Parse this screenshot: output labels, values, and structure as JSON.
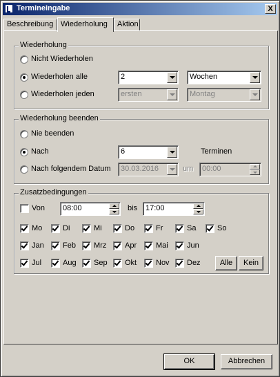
{
  "window": {
    "title": "Termineingabe",
    "close_glyph": "X"
  },
  "tabs": [
    "Beschreibung",
    "Wiederholung",
    "Aktion"
  ],
  "active_tab": "Wiederholung",
  "wiederholung": {
    "legend": "Wiederholung",
    "options": {
      "nicht": "Nicht Wiederholen",
      "alle": "Wiederholen alle",
      "jeden": "Wiederholen jeden"
    },
    "selected": "alle",
    "alle_count": "2",
    "alle_unit": "Wochen",
    "jeden_which": "ersten",
    "jeden_day": "Montag"
  },
  "beenden": {
    "legend": "Wiederholung beenden",
    "options": {
      "nie": "Nie beenden",
      "nach": "Nach",
      "datum": "Nach folgendem Datum"
    },
    "selected": "nach",
    "nach_count": "6",
    "terminen_label": "Terminen",
    "date": "30.03.2016",
    "um_label": "um",
    "time": "00:00"
  },
  "zusatz": {
    "legend": "Zusatzbedingungen",
    "von_label": "Von",
    "von_checked": false,
    "von_time": "08:00",
    "bis_label": "bis",
    "bis_time": "17:00",
    "weekdays": [
      {
        "label": "Mo",
        "checked": true
      },
      {
        "label": "Di",
        "checked": true
      },
      {
        "label": "Mi",
        "checked": true
      },
      {
        "label": "Do",
        "checked": true
      },
      {
        "label": "Fr",
        "checked": true
      },
      {
        "label": "Sa",
        "checked": true
      },
      {
        "label": "So",
        "checked": true
      }
    ],
    "months_row1": [
      {
        "label": "Jan",
        "checked": true
      },
      {
        "label": "Feb",
        "checked": true
      },
      {
        "label": "Mrz",
        "checked": true
      },
      {
        "label": "Apr",
        "checked": true
      },
      {
        "label": "Mai",
        "checked": true
      },
      {
        "label": "Jun",
        "checked": true
      }
    ],
    "months_row2": [
      {
        "label": "Jul",
        "checked": true
      },
      {
        "label": "Aug",
        "checked": true
      },
      {
        "label": "Sep",
        "checked": true
      },
      {
        "label": "Okt",
        "checked": true
      },
      {
        "label": "Nov",
        "checked": true
      },
      {
        "label": "Dez",
        "checked": true
      }
    ],
    "alle_button": "Alle",
    "kein_button": "Kein"
  },
  "footer": {
    "ok": "OK",
    "cancel": "Abbrechen"
  },
  "colors": {
    "face": "#d4d0c8",
    "title_start": "#0a246a",
    "title_end": "#a6caf0"
  },
  "icons": {
    "app": "calendar-app-icon",
    "close": "close-icon"
  }
}
